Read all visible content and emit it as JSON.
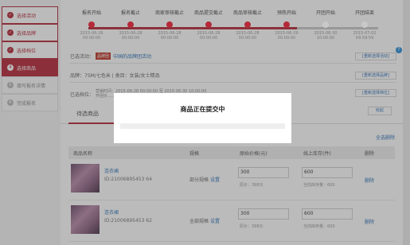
{
  "sidebar": {
    "items": [
      {
        "label": "选择活动",
        "state": "done",
        "icon": "check"
      },
      {
        "label": "选择品牌",
        "state": "done",
        "icon": "check"
      },
      {
        "label": "选择档位",
        "state": "done",
        "icon": "check"
      },
      {
        "label": "选择商品",
        "state": "active",
        "icon": "step-4"
      },
      {
        "label": "填写报名详情",
        "state": "plain",
        "icon": "step-5"
      },
      {
        "label": "完成报名",
        "state": "plain",
        "icon": "step-6"
      }
    ]
  },
  "steps": [
    {
      "label": "报名开始",
      "date": "2015-06-26 00:00:00",
      "on": true
    },
    {
      "label": "报名截止",
      "date": "2015-06-28 00:00:00",
      "on": true
    },
    {
      "label": "商家审核截止",
      "date": "2015-06-28 00:00:00",
      "on": true
    },
    {
      "label": "商品提交截止",
      "date": "2015-06-28 00:00:00",
      "on": true
    },
    {
      "label": "商品审核截止",
      "date": "2015-06-28 00:00:00",
      "on": true
    },
    {
      "label": "预热开始",
      "date": "2015-06-29 00:00:00",
      "on": true
    },
    {
      "label": "开团开始",
      "date": "2015-06-30 10:00:00",
      "on": false
    },
    {
      "label": "开团结束",
      "date": "2015-07-02 09:59:59",
      "on": false
    }
  ],
  "progress": {
    "completed_fraction": 0.72
  },
  "info": {
    "activity_label": "已选活动：",
    "activity_badge": "品牌团",
    "activity_name": "中国的品牌团活动",
    "reselect_activity": "[重新选择活动]",
    "brand_text": "品牌：7SM/七色米 | 类目：女装/女士精品",
    "reselect_brand": "[重新选择品牌]",
    "tier_label": "已选档位：",
    "tier_text_1": "营销时间：2015-06-28 00:00:00 至 2015-06-30 10:00:00",
    "tier_text_2": "开团价……",
    "reselect_tier": "[重新选择档位]"
  },
  "tabs": {
    "pending": "待选商品",
    "collapse": "收起"
  },
  "select_all": "全选删除",
  "table": {
    "headers": [
      "商品名称",
      "规格",
      "原始价格(元)",
      "线上库存(件)",
      "删除"
    ],
    "rows": [
      {
        "name": "连衣裙",
        "id": "ID:21006895453 64",
        "spec": "部分规格",
        "spec_link": "设置",
        "price": "300",
        "orig_price": "原价：398元",
        "stock": "600",
        "cur_stock": "当前库存量：600",
        "delete": "删除"
      },
      {
        "name": "连衣裙",
        "id": "ID:21006895453 62",
        "spec": "全部规格",
        "spec_link": "设置",
        "price": "300",
        "orig_price": "原价：398元",
        "stock": "600",
        "cur_stock": "当前库存量：600",
        "delete": "删除"
      }
    ]
  },
  "modal": {
    "title": "商品正在提交中",
    "progress": 0
  },
  "colors": {
    "accent": "#b52a39",
    "link": "#2f72b8"
  }
}
